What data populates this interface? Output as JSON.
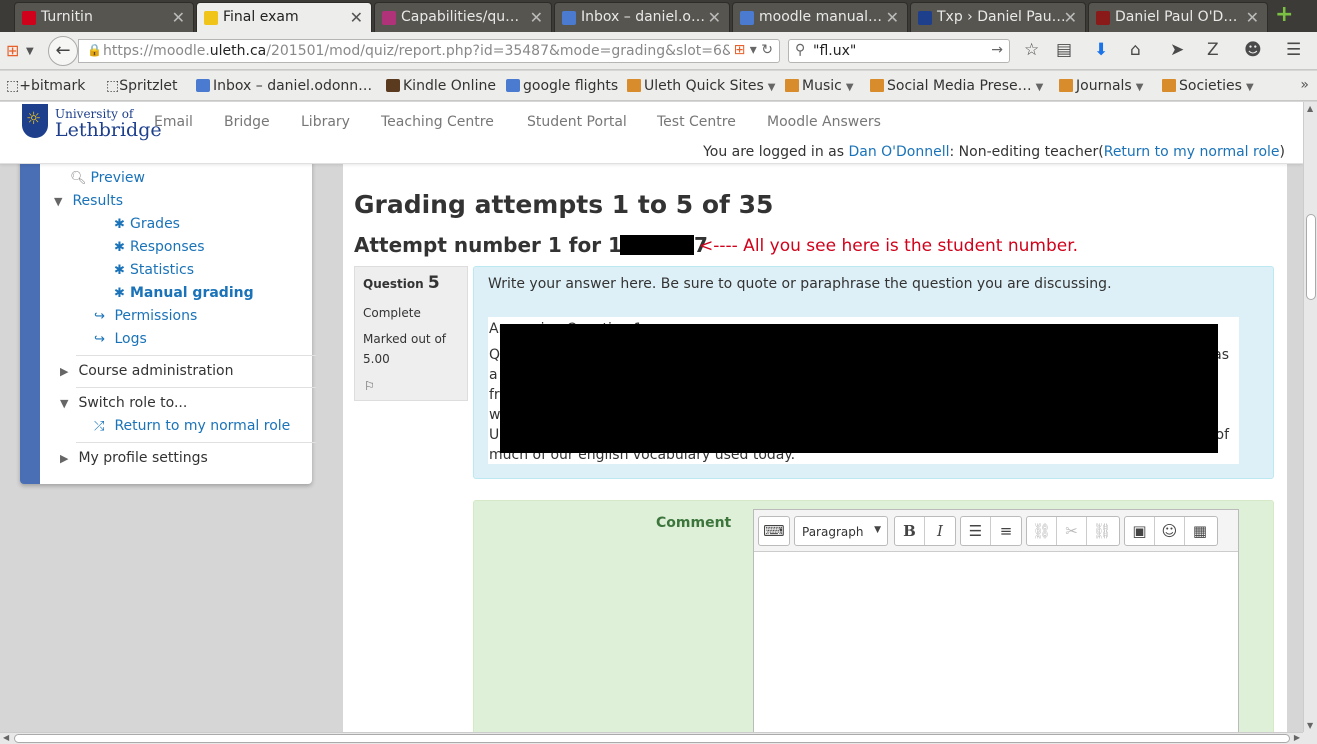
{
  "browser": {
    "tabs": [
      {
        "label": "Turnitin",
        "favicon_color": "#d0021b"
      },
      {
        "label": "Final exam",
        "favicon_color": "#f0c419"
      },
      {
        "label": "Capabilities/qu…",
        "favicon_color": "#b0337a"
      },
      {
        "label": "Inbox – daniel.o…",
        "favicon_color": "#4a7bd0"
      },
      {
        "label": "moodle manual…",
        "favicon_color": "#4a7bd0"
      },
      {
        "label": "Txp › Daniel Pau…",
        "favicon_color": "#1d3f8c"
      },
      {
        "label": "Daniel Paul O'D…",
        "favicon_color": "#8a1a1a"
      }
    ],
    "url_prefix": "https://moodle.",
    "url_domain": "uleth.ca",
    "url_rest": "/201501/mod/quiz/report.php?id=35487&mode=grading&slot=6&qi",
    "search_value": "\"fl.ux\"",
    "bookmarks": [
      {
        "label": "bitmark",
        "type": "plain"
      },
      {
        "label": "Spritzlet",
        "type": "plain"
      },
      {
        "label": "Inbox – daniel.odonn…",
        "type": "mail"
      },
      {
        "label": "Kindle Online",
        "type": "kindle"
      },
      {
        "label": "google flights",
        "type": "google"
      },
      {
        "label": "Uleth Quick Sites",
        "type": "folder"
      },
      {
        "label": "Music",
        "type": "folder"
      },
      {
        "label": "Social Media Prese…",
        "type": "folder"
      },
      {
        "label": "Journals",
        "type": "folder"
      },
      {
        "label": "Societies",
        "type": "folder"
      }
    ]
  },
  "site": {
    "logo_line1": "University of",
    "logo_line2": "Lethbridge",
    "nav": [
      "Email",
      "Bridge",
      "Library",
      "Teaching Centre",
      "Student Portal",
      "Test Centre",
      "Moodle Answers"
    ],
    "logged_in_prefix": "You are logged in as ",
    "user_name": "Dan O'Donnell",
    "role_text": ": Non-editing teacher(",
    "return_role_link": "Return to my normal role",
    "role_close": ")"
  },
  "sidebar": {
    "preview": "Preview",
    "results": "Results",
    "grades": "Grades",
    "responses": "Responses",
    "statistics": "Statistics",
    "manual_grading": "Manual grading",
    "permissions": "Permissions",
    "logs": "Logs",
    "course_admin": "Course administration",
    "switch_role": "Switch role to...",
    "return_normal_role": "Return to my normal role",
    "profile_settings": "My profile settings"
  },
  "main": {
    "heading": "Grading attempts 1 to 5 of 35",
    "attempt_prefix": "Attempt number 1 for 1",
    "attempt_suffix": "7",
    "annotation": "<---- All you see here is the student number.",
    "question_label": "Question",
    "question_number": "5",
    "status": "Complete",
    "marked_out_of": "Marked out of",
    "marks": "5.00",
    "prompt": "Write your answer here. Be sure to quote or paraphrase the question you are discussing.",
    "answer_line1": "Answering Question 1",
    "answer_line2_start": "Q",
    "answer_line2_end": "as",
    "answer_line3_start": "a",
    "answer_line4_start": "fr",
    "answer_line5_start": "w",
    "answer_line6_start": "U",
    "answer_line6_end": "of",
    "answer_line7": "much of our english vocabulary used today.",
    "comment_label": "Comment",
    "paragraph_select": "Paragraph"
  }
}
